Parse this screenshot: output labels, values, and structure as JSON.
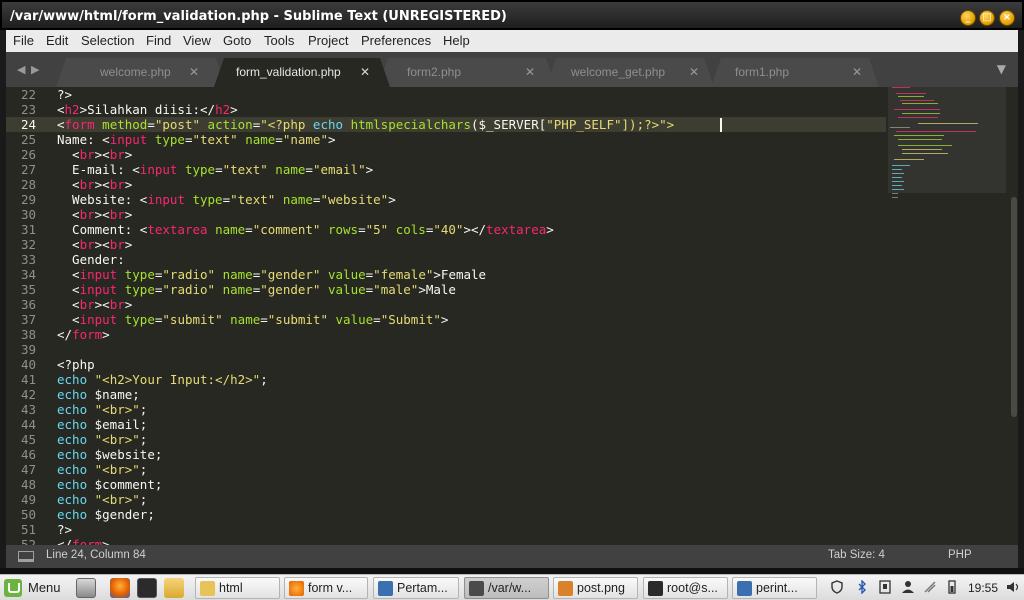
{
  "window": {
    "title": "/var/www/html/form_validation.php - Sublime Text (UNREGISTERED)"
  },
  "menu": [
    "File",
    "Edit",
    "Selection",
    "Find",
    "View",
    "Goto",
    "Tools",
    "Project",
    "Preferences",
    "Help"
  ],
  "tabs": [
    {
      "label": "welcome.php",
      "active": false
    },
    {
      "label": "form_validation.php",
      "active": true
    },
    {
      "label": "form2.php",
      "active": false
    },
    {
      "label": "welcome_get.php",
      "active": false
    },
    {
      "label": "form1.php",
      "active": false
    }
  ],
  "editor": {
    "current_line": 24,
    "lines": [
      {
        "n": "22",
        "tokens": [
          {
            "t": "?>",
            "c": "var"
          }
        ]
      },
      {
        "n": "23",
        "tokens": [
          {
            "t": "<",
            "c": "var"
          },
          {
            "t": "h2",
            "c": "tag"
          },
          {
            "t": ">Silahkan diisi:</",
            "c": "var"
          },
          {
            "t": "h2",
            "c": "tag"
          },
          {
            "t": ">",
            "c": "var"
          }
        ]
      },
      {
        "n": "24",
        "tokens": [
          {
            "t": "<",
            "c": "var"
          },
          {
            "t": "form",
            "c": "tag"
          },
          {
            "t": " ",
            "c": "var"
          },
          {
            "t": "method",
            "c": "attr"
          },
          {
            "t": "=",
            "c": "var"
          },
          {
            "t": "\"post\"",
            "c": "str"
          },
          {
            "t": " ",
            "c": "var"
          },
          {
            "t": "action",
            "c": "attr"
          },
          {
            "t": "=",
            "c": "var"
          },
          {
            "t": "\"<?php ",
            "c": "str"
          },
          {
            "t": "echo",
            "c": "kw"
          },
          {
            "t": " ",
            "c": "var"
          },
          {
            "t": "htmlspecialchars",
            "c": "attr"
          },
          {
            "t": "($_SERVER[",
            "c": "var"
          },
          {
            "t": "\"PHP_SELF\"",
            "c": "str"
          },
          {
            "t": "]);?>\">",
            "c": "str"
          }
        ]
      },
      {
        "n": "25",
        "tokens": [
          {
            "t": "Name: <",
            "c": "var"
          },
          {
            "t": "input",
            "c": "tag"
          },
          {
            "t": " ",
            "c": "var"
          },
          {
            "t": "type",
            "c": "attr"
          },
          {
            "t": "=",
            "c": "var"
          },
          {
            "t": "\"text\"",
            "c": "str"
          },
          {
            "t": " ",
            "c": "var"
          },
          {
            "t": "name",
            "c": "attr"
          },
          {
            "t": "=",
            "c": "var"
          },
          {
            "t": "\"name\"",
            "c": "str"
          },
          {
            "t": ">",
            "c": "var"
          }
        ]
      },
      {
        "n": "26",
        "tokens": [
          {
            "t": "  <",
            "c": "var"
          },
          {
            "t": "br",
            "c": "tag"
          },
          {
            "t": "><",
            "c": "var"
          },
          {
            "t": "br",
            "c": "tag"
          },
          {
            "t": ">",
            "c": "var"
          }
        ]
      },
      {
        "n": "27",
        "tokens": [
          {
            "t": "  E-mail: <",
            "c": "var"
          },
          {
            "t": "input",
            "c": "tag"
          },
          {
            "t": " ",
            "c": "var"
          },
          {
            "t": "type",
            "c": "attr"
          },
          {
            "t": "=",
            "c": "var"
          },
          {
            "t": "\"text\"",
            "c": "str"
          },
          {
            "t": " ",
            "c": "var"
          },
          {
            "t": "name",
            "c": "attr"
          },
          {
            "t": "=",
            "c": "var"
          },
          {
            "t": "\"email\"",
            "c": "str"
          },
          {
            "t": ">",
            "c": "var"
          }
        ]
      },
      {
        "n": "28",
        "tokens": [
          {
            "t": "  <",
            "c": "var"
          },
          {
            "t": "br",
            "c": "tag"
          },
          {
            "t": "><",
            "c": "var"
          },
          {
            "t": "br",
            "c": "tag"
          },
          {
            "t": ">",
            "c": "var"
          }
        ]
      },
      {
        "n": "29",
        "tokens": [
          {
            "t": "  Website: <",
            "c": "var"
          },
          {
            "t": "input",
            "c": "tag"
          },
          {
            "t": " ",
            "c": "var"
          },
          {
            "t": "type",
            "c": "attr"
          },
          {
            "t": "=",
            "c": "var"
          },
          {
            "t": "\"text\"",
            "c": "str"
          },
          {
            "t": " ",
            "c": "var"
          },
          {
            "t": "name",
            "c": "attr"
          },
          {
            "t": "=",
            "c": "var"
          },
          {
            "t": "\"website\"",
            "c": "str"
          },
          {
            "t": ">",
            "c": "var"
          }
        ]
      },
      {
        "n": "30",
        "tokens": [
          {
            "t": "  <",
            "c": "var"
          },
          {
            "t": "br",
            "c": "tag"
          },
          {
            "t": "><",
            "c": "var"
          },
          {
            "t": "br",
            "c": "tag"
          },
          {
            "t": ">",
            "c": "var"
          }
        ]
      },
      {
        "n": "31",
        "tokens": [
          {
            "t": "  Comment: <",
            "c": "var"
          },
          {
            "t": "textarea",
            "c": "tag"
          },
          {
            "t": " ",
            "c": "var"
          },
          {
            "t": "name",
            "c": "attr"
          },
          {
            "t": "=",
            "c": "var"
          },
          {
            "t": "\"comment\"",
            "c": "str"
          },
          {
            "t": " ",
            "c": "var"
          },
          {
            "t": "rows",
            "c": "attr"
          },
          {
            "t": "=",
            "c": "var"
          },
          {
            "t": "\"5\"",
            "c": "str"
          },
          {
            "t": " ",
            "c": "var"
          },
          {
            "t": "cols",
            "c": "attr"
          },
          {
            "t": "=",
            "c": "var"
          },
          {
            "t": "\"40\"",
            "c": "str"
          },
          {
            "t": "></",
            "c": "var"
          },
          {
            "t": "textarea",
            "c": "tag"
          },
          {
            "t": ">",
            "c": "var"
          }
        ]
      },
      {
        "n": "32",
        "tokens": [
          {
            "t": "  <",
            "c": "var"
          },
          {
            "t": "br",
            "c": "tag"
          },
          {
            "t": "><",
            "c": "var"
          },
          {
            "t": "br",
            "c": "tag"
          },
          {
            "t": ">",
            "c": "var"
          }
        ]
      },
      {
        "n": "33",
        "tokens": [
          {
            "t": "  Gender:",
            "c": "var"
          }
        ]
      },
      {
        "n": "34",
        "tokens": [
          {
            "t": "  <",
            "c": "var"
          },
          {
            "t": "input",
            "c": "tag"
          },
          {
            "t": " ",
            "c": "var"
          },
          {
            "t": "type",
            "c": "attr"
          },
          {
            "t": "=",
            "c": "var"
          },
          {
            "t": "\"radio\"",
            "c": "str"
          },
          {
            "t": " ",
            "c": "var"
          },
          {
            "t": "name",
            "c": "attr"
          },
          {
            "t": "=",
            "c": "var"
          },
          {
            "t": "\"gender\"",
            "c": "str"
          },
          {
            "t": " ",
            "c": "var"
          },
          {
            "t": "value",
            "c": "attr"
          },
          {
            "t": "=",
            "c": "var"
          },
          {
            "t": "\"female\"",
            "c": "str"
          },
          {
            "t": ">Female",
            "c": "var"
          }
        ]
      },
      {
        "n": "35",
        "tokens": [
          {
            "t": "  <",
            "c": "var"
          },
          {
            "t": "input",
            "c": "tag"
          },
          {
            "t": " ",
            "c": "var"
          },
          {
            "t": "type",
            "c": "attr"
          },
          {
            "t": "=",
            "c": "var"
          },
          {
            "t": "\"radio\"",
            "c": "str"
          },
          {
            "t": " ",
            "c": "var"
          },
          {
            "t": "name",
            "c": "attr"
          },
          {
            "t": "=",
            "c": "var"
          },
          {
            "t": "\"gender\"",
            "c": "str"
          },
          {
            "t": " ",
            "c": "var"
          },
          {
            "t": "value",
            "c": "attr"
          },
          {
            "t": "=",
            "c": "var"
          },
          {
            "t": "\"male\"",
            "c": "str"
          },
          {
            "t": ">Male",
            "c": "var"
          }
        ]
      },
      {
        "n": "36",
        "tokens": [
          {
            "t": "  <",
            "c": "var"
          },
          {
            "t": "br",
            "c": "tag"
          },
          {
            "t": "><",
            "c": "var"
          },
          {
            "t": "br",
            "c": "tag"
          },
          {
            "t": ">",
            "c": "var"
          }
        ]
      },
      {
        "n": "37",
        "tokens": [
          {
            "t": "  <",
            "c": "var"
          },
          {
            "t": "input",
            "c": "tag"
          },
          {
            "t": " ",
            "c": "var"
          },
          {
            "t": "type",
            "c": "attr"
          },
          {
            "t": "=",
            "c": "var"
          },
          {
            "t": "\"submit\"",
            "c": "str"
          },
          {
            "t": " ",
            "c": "var"
          },
          {
            "t": "name",
            "c": "attr"
          },
          {
            "t": "=",
            "c": "var"
          },
          {
            "t": "\"submit\"",
            "c": "str"
          },
          {
            "t": " ",
            "c": "var"
          },
          {
            "t": "value",
            "c": "attr"
          },
          {
            "t": "=",
            "c": "var"
          },
          {
            "t": "\"Submit\"",
            "c": "str"
          },
          {
            "t": ">",
            "c": "var"
          }
        ]
      },
      {
        "n": "38",
        "tokens": [
          {
            "t": "</",
            "c": "var"
          },
          {
            "t": "form",
            "c": "tag"
          },
          {
            "t": ">",
            "c": "var"
          }
        ]
      },
      {
        "n": "39",
        "tokens": []
      },
      {
        "n": "40",
        "tokens": [
          {
            "t": "<?php",
            "c": "var"
          }
        ]
      },
      {
        "n": "41",
        "tokens": [
          {
            "t": "echo",
            "c": "kw"
          },
          {
            "t": " ",
            "c": "var"
          },
          {
            "t": "\"<h2>Your Input:</h2>\"",
            "c": "str"
          },
          {
            "t": ";",
            "c": "var"
          }
        ]
      },
      {
        "n": "42",
        "tokens": [
          {
            "t": "echo",
            "c": "kw"
          },
          {
            "t": " $name;",
            "c": "var"
          }
        ]
      },
      {
        "n": "43",
        "tokens": [
          {
            "t": "echo",
            "c": "kw"
          },
          {
            "t": " ",
            "c": "var"
          },
          {
            "t": "\"<br>\"",
            "c": "str"
          },
          {
            "t": ";",
            "c": "var"
          }
        ]
      },
      {
        "n": "44",
        "tokens": [
          {
            "t": "echo",
            "c": "kw"
          },
          {
            "t": " $email;",
            "c": "var"
          }
        ]
      },
      {
        "n": "45",
        "tokens": [
          {
            "t": "echo",
            "c": "kw"
          },
          {
            "t": " ",
            "c": "var"
          },
          {
            "t": "\"<br>\"",
            "c": "str"
          },
          {
            "t": ";",
            "c": "var"
          }
        ]
      },
      {
        "n": "46",
        "tokens": [
          {
            "t": "echo",
            "c": "kw"
          },
          {
            "t": " $website;",
            "c": "var"
          }
        ]
      },
      {
        "n": "47",
        "tokens": [
          {
            "t": "echo",
            "c": "kw"
          },
          {
            "t": " ",
            "c": "var"
          },
          {
            "t": "\"<br>\"",
            "c": "str"
          },
          {
            "t": ";",
            "c": "var"
          }
        ]
      },
      {
        "n": "48",
        "tokens": [
          {
            "t": "echo",
            "c": "kw"
          },
          {
            "t": " $comment;",
            "c": "var"
          }
        ]
      },
      {
        "n": "49",
        "tokens": [
          {
            "t": "echo",
            "c": "kw"
          },
          {
            "t": " ",
            "c": "var"
          },
          {
            "t": "\"<br>\"",
            "c": "str"
          },
          {
            "t": ";",
            "c": "var"
          }
        ]
      },
      {
        "n": "50",
        "tokens": [
          {
            "t": "echo",
            "c": "kw"
          },
          {
            "t": " $gender;",
            "c": "var"
          }
        ]
      },
      {
        "n": "51",
        "tokens": [
          {
            "t": "?>",
            "c": "var"
          }
        ]
      },
      {
        "n": "52",
        "tokens": [
          {
            "t": "</",
            "c": "var"
          },
          {
            "t": "form",
            "c": "tag"
          },
          {
            "t": ">",
            "c": "var"
          }
        ]
      }
    ]
  },
  "status": {
    "position": "Line 24, Column 84",
    "tab_size": "Tab Size: 4",
    "syntax": "PHP"
  },
  "taskbar": {
    "menu_label": "Menu",
    "tasks": [
      {
        "label": "html",
        "icon": "folder-icon",
        "color": "#e8c35a"
      },
      {
        "label": "form v...",
        "icon": "firefox-icon",
        "color": "#e66000"
      },
      {
        "label": "Pertam...",
        "icon": "document-icon",
        "color": "#3a6fb0"
      },
      {
        "label": "/var/w...",
        "icon": "sublime-icon",
        "color": "#4b4b4b",
        "active": true
      },
      {
        "label": "post.png",
        "icon": "image-viewer-icon",
        "color": "#d9822b"
      },
      {
        "label": "root@s...",
        "icon": "terminal-icon",
        "color": "#2b2b2b"
      },
      {
        "label": "perint...",
        "icon": "document-icon",
        "color": "#3a6fb0"
      }
    ],
    "clock": "19:55"
  },
  "colors": {
    "editor_bg": "#272822",
    "keyword": "#66d9ef",
    "tag": "#f92672",
    "attribute": "#a6e22e",
    "string": "#e6db74"
  }
}
